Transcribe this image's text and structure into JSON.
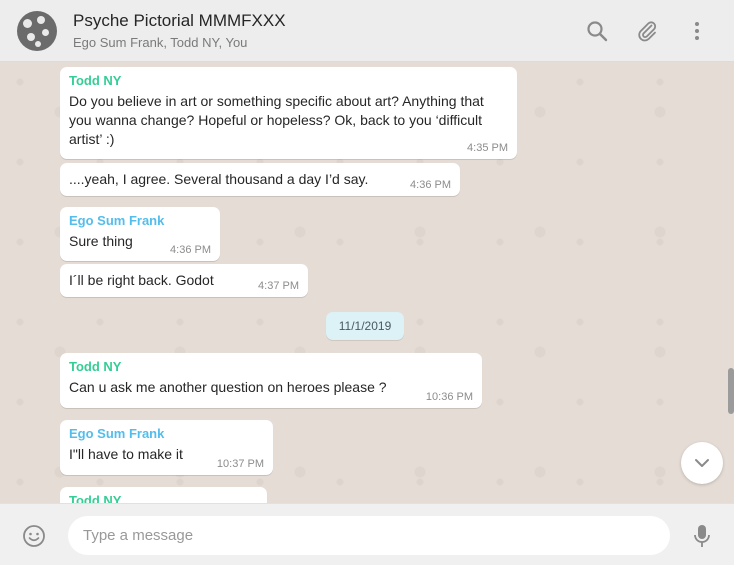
{
  "header": {
    "title": "Psyche Pictorial MMMFXXX",
    "subtitle": "Ego Sum Frank, Todd NY, You",
    "icons": [
      "search-icon",
      "attach-icon",
      "menu-icon"
    ]
  },
  "messages": [
    {
      "sender": "Todd NY",
      "text": "Do you believe in art or something specific about art? Anything that you wanna change? Hopeful or hopeless? Ok, back to you ‘difficult artist’ :)",
      "time": "4:35 PM"
    },
    {
      "sender": "",
      "text": "....yeah, I agree. Several thousand a day I’d say.",
      "time": "4:36 PM"
    },
    {
      "sender": "Ego Sum Frank",
      "text": "Sure thing",
      "time": "4:36 PM"
    },
    {
      "sender": "",
      "text": "I´ll be right back. Godot",
      "time": "4:37 PM"
    },
    {
      "sender": "Todd NY",
      "text": "Can u ask me another question on heroes please ?",
      "time": "10:36 PM"
    },
    {
      "sender": "Ego Sum Frank",
      "text": "I\"ll have to make it",
      "time": "10:37 PM"
    },
    {
      "sender": "Todd NY",
      "text": "",
      "time": ""
    }
  ],
  "date_divider": "11/1/2019",
  "composer": {
    "placeholder": "Type a message",
    "icons": [
      "emoji-icon",
      "mic-icon"
    ]
  },
  "colors": {
    "todd": "#35cd96",
    "ego": "#53bdeb",
    "header_bg": "#ededed",
    "chat_bg": "#e5ddd5"
  }
}
